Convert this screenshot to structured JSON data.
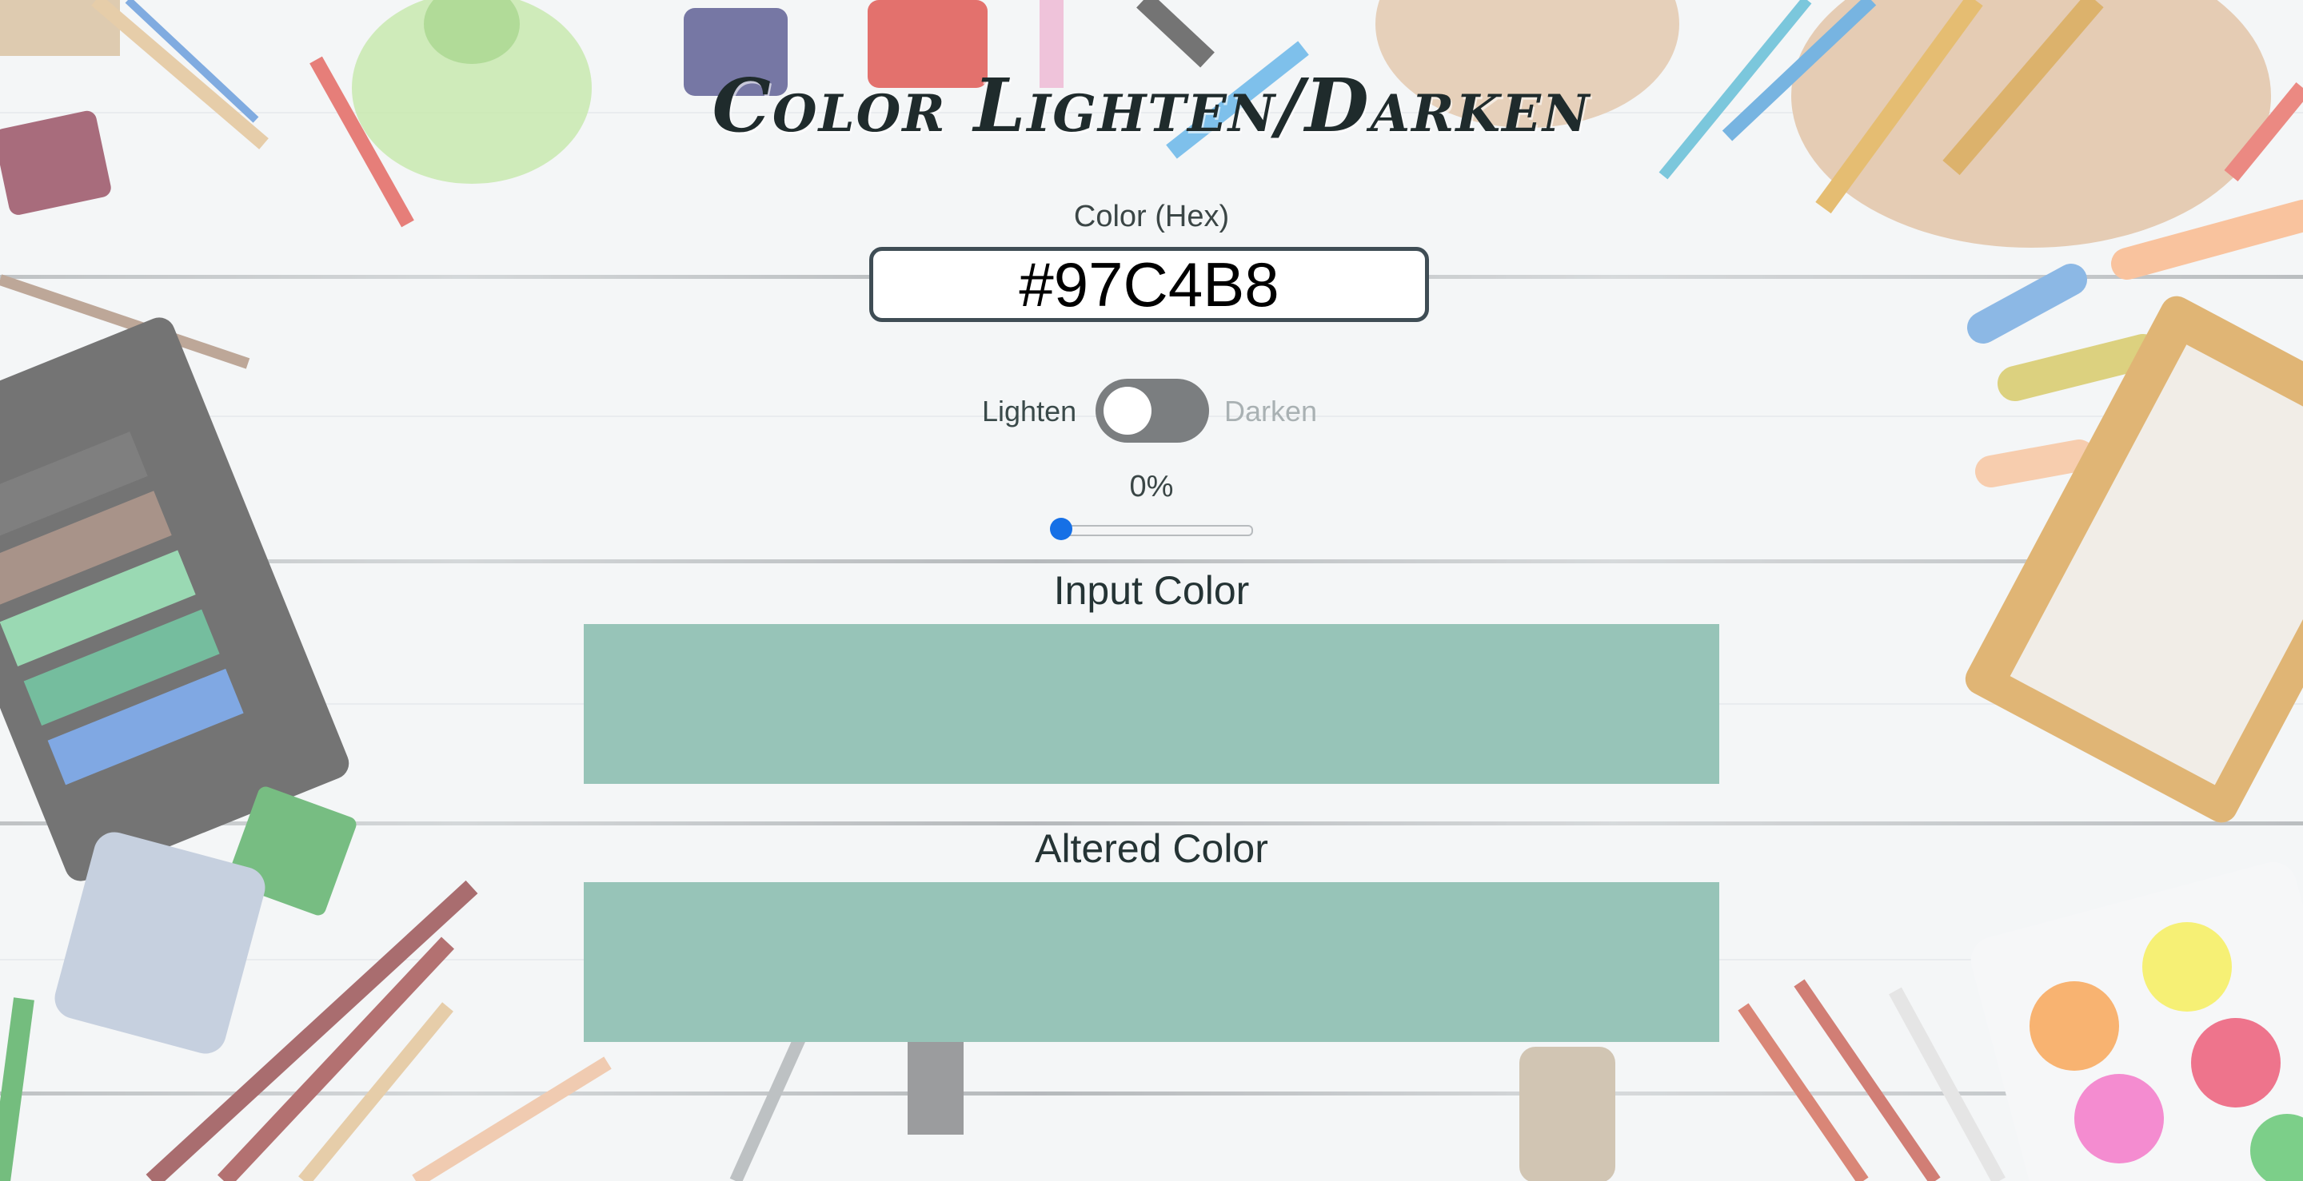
{
  "app": {
    "title": "Color Lighten/Darken"
  },
  "hex_field": {
    "label": "Color (Hex)",
    "value": "#97C4B8"
  },
  "mode_toggle": {
    "left_label": "Lighten",
    "right_label": "Darken",
    "state": "Lighten"
  },
  "amount": {
    "display": "0%",
    "value": 0
  },
  "input_swatch": {
    "label": "Input Color",
    "color": "#97C4B8"
  },
  "altered_swatch": {
    "label": "Altered Color",
    "color": "#97C4B8"
  },
  "colors": {
    "toggle_track": "#7B7E80",
    "slider_thumb": "#1670E6",
    "title_text": "#1F2B2C"
  }
}
